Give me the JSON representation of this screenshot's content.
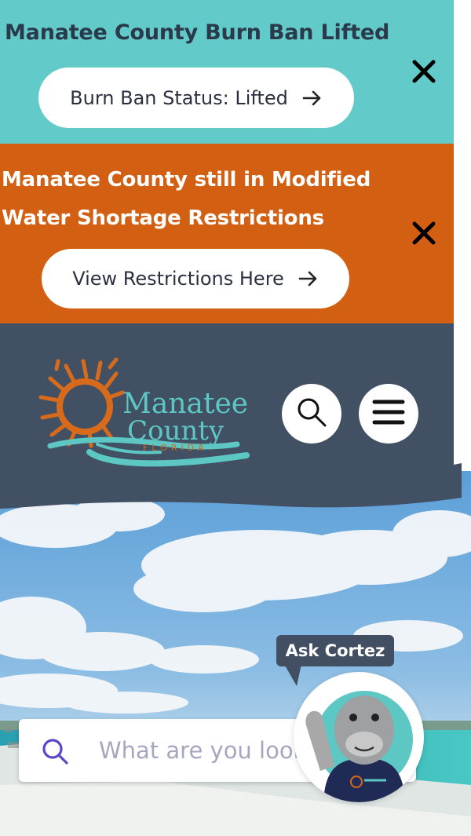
{
  "alerts": [
    {
      "title": "Manatee County Burn Ban Lifted",
      "button_label": "Burn Ban Status: Lifted",
      "background": "#62cbc9"
    },
    {
      "title_lines": [
        "Manatee County still in Modified",
        "Water Shortage Restrictions"
      ],
      "button_label": "View Restrictions Here",
      "background": "#d35f12"
    }
  ],
  "header": {
    "background": "#415063",
    "logo": {
      "word1": "Manatee",
      "word2": "County",
      "state": "FLORIDA"
    },
    "search_button_icon": "search-icon",
    "menu_button_icon": "hamburger-menu-icon"
  },
  "search": {
    "placeholder": "What are you looking for?",
    "icon": "search-icon"
  },
  "chatbot": {
    "label": "Ask Cortez",
    "avatar": "manatee-mascot"
  }
}
